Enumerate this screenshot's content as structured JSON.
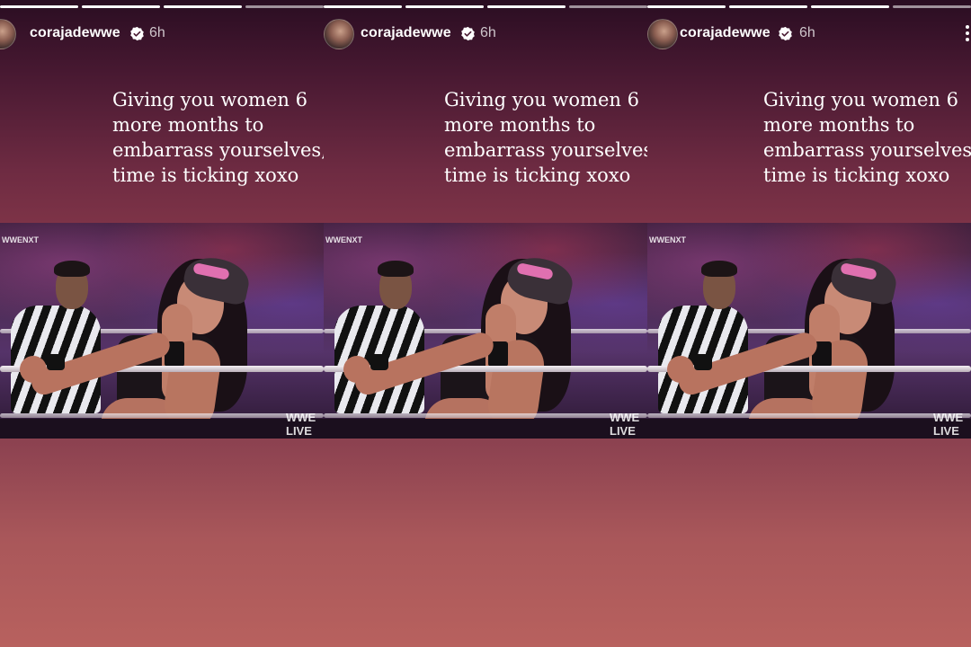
{
  "stories": [
    {
      "username": "corajadewwe",
      "time": "6h",
      "caption": "Giving you women 6 more months to embarrass yourselves, time is ticking xoxo",
      "photo_watermark_top": "WWENXT",
      "photo_watermark_bottom": "WWE LIVE"
    },
    {
      "username": "corajadewwe",
      "time": "6h",
      "caption": "Giving you women 6 more months to embarrass yourselves, time is ticking xoxo",
      "photo_watermark_top": "WWENXT",
      "photo_watermark_bottom": "WWE LIVE"
    },
    {
      "username": "corajadewwe",
      "time": "6h",
      "caption": "Giving you women 6 more months to embarrass yourselves, time is ticking xoxo",
      "photo_watermark_top": "WWENXT",
      "photo_watermark_bottom": "WWE LIVE"
    }
  ],
  "icons": {
    "verified": "verified-badge-icon",
    "more": "more-vertical-icon"
  },
  "colors": {
    "text": "#ffffff",
    "background_bottom": "#b8615e",
    "background_top": "#2a0d22",
    "headband": "#e070b0"
  }
}
